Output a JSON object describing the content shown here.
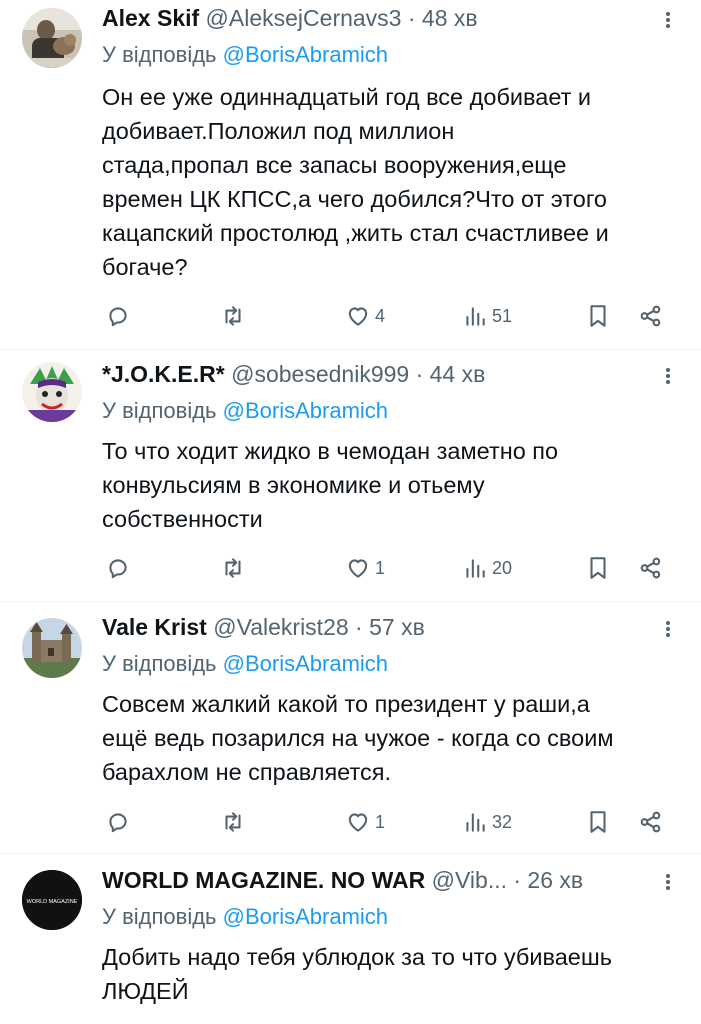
{
  "reply_prefix": "У відповідь",
  "tweets": [
    {
      "name": "Alex Skif",
      "handle_time": "@AleksejCernavs3 · 48 хв",
      "mention": "@BorisAbramich",
      "text": "Он ее уже одиннадцатый год все добивает и\nдобивает.Положил под миллион\nстада,пропал все запасы вооружения,еще\nвремен ЦК КПСС,а чего добился?Что от этого\nкацапский простолюд ,жить стал счастливее и\nбогаче?",
      "likes": "4",
      "views": "51"
    },
    {
      "name": "*J.O.K.E.R*",
      "handle_time": "@sobesednik999 · 44 хв",
      "mention": "@BorisAbramich",
      "text": "То что ходит жидко в чемодан заметно по\nконвульсиям в экономике и отьему\nсобственности",
      "likes": "1",
      "views": "20"
    },
    {
      "name": "Vale Krist",
      "handle_time": "@Valekrist28 · 57 хв",
      "mention": "@BorisAbramich",
      "text": "Совсем жалкий какой то президент у раши,а\nещё ведь позарился на чужое - когда со своим\nбарахлом не справляется.",
      "likes": "1",
      "views": "32"
    },
    {
      "name": "WORLD MAGAZINE. NO WAR",
      "handle_time": "@Vib... · 26 хв",
      "mention": "@BorisAbramich",
      "text": "Добить надо тебя ублюдок за то что убиваешь\nЛЮДЕЙ",
      "avatar_text": "WORLD MAGAZINE"
    }
  ]
}
